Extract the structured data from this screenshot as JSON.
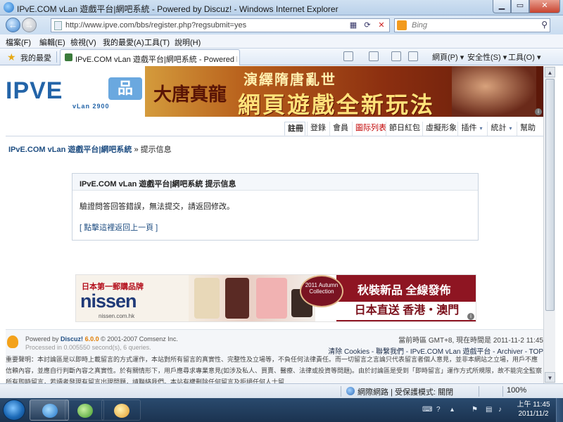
{
  "window": {
    "title": "IPvE.COM vLan 遊戲平台|網吧系統 - Powered by Discuz! - Windows Internet Explorer"
  },
  "address": {
    "url": "http://www.ipve.com/bbs/register.php?regsubmit=yes"
  },
  "search": {
    "placeholder": "Bing"
  },
  "menu": [
    "檔案(F)",
    "編輯(E)",
    "檢視(V)",
    "我的最愛(A)",
    "工具(T)",
    "說明(H)"
  ],
  "favorites": {
    "label": "我的最愛",
    "tab_title": "IPvE.COM vLan 遊戲平台|網吧系統 - Powered b..."
  },
  "toolbar": {
    "page": "網頁(P) ▾",
    "safety": "安全性(S) ▾",
    "tools": "工具(O) ▾"
  },
  "banner": {
    "logo_text": "IPVE",
    "logo_badge": "品",
    "logo_sub": "vLan 2900",
    "ad_brand": "大唐真龍",
    "ad_line1": "演繹隋唐亂世",
    "ad_line2": "網頁遊戲全新玩法"
  },
  "nav": {
    "tabs": [
      "註冊",
      "登錄",
      "會員",
      "圖际列表",
      "節日紅包",
      "虛擬形象",
      "插件",
      "統計",
      "幫助"
    ],
    "active": "註冊"
  },
  "breadcrumb": {
    "home": "IPvE.COM vLan 遊戲平台|網吧系統",
    "sep": "»",
    "current": "提示信息"
  },
  "message": {
    "title": "IPvE.COM vLan 遊戲平台|網吧系統 提示信息",
    "body": "驗證問答回答錯誤，無法提交，請返回修改。",
    "back_link": "[ 點擊這裡返回上一頁 ]"
  },
  "ad2": {
    "tag": "日本第一郵購品牌",
    "brand": "nissen",
    "site": "nissen.com.hk",
    "badge": "2011 Autumn Collection",
    "headline": "秋裝新品  全線發佈",
    "subline": "日本直送  香港・澳門"
  },
  "footer": {
    "powered": "Powered by",
    "product": "Discuz!",
    "version": "6.0.0",
    "copyright": "© 2001-2007 Comsenz Inc.",
    "processed": "Processed in 0.005550 second(s), 6 queries.",
    "time": "當前時區 GMT+8, 現在時間是 2011-11-2 11:45",
    "links": "清除 Cookies - 聯繫我們 - IPvE.COM vLan 遊戲平台 - Archiver - TOP",
    "disclaimer": "重要聲明：本討論區是以即時上載留言的方式運作，本站對所有留言的真實性、完整性及立場等，不負任何法律責任。而一切留言之言論只代表留言者個人意見，並非本網站之立場，用戶不應信賴內容，並應自行判斷內容之真實性。於有關情形下，用戶應尋求專業意見(如涉及私人、買賣、醫療、法律或投資等問題)。由於討論區是受到「即時留言」運作方式所規限，故不能完全監察所有即時留言，若讀者發現有留言出現問題，請聯絡我們。本站有權刪除任何留言及拒絕任何人士留"
  },
  "status": {
    "zone": "網際網路 | 受保護模式: 關閉",
    "zoom": "100%"
  },
  "taskbar": {
    "time": "上午 11:45",
    "date": "2011/11/2"
  }
}
